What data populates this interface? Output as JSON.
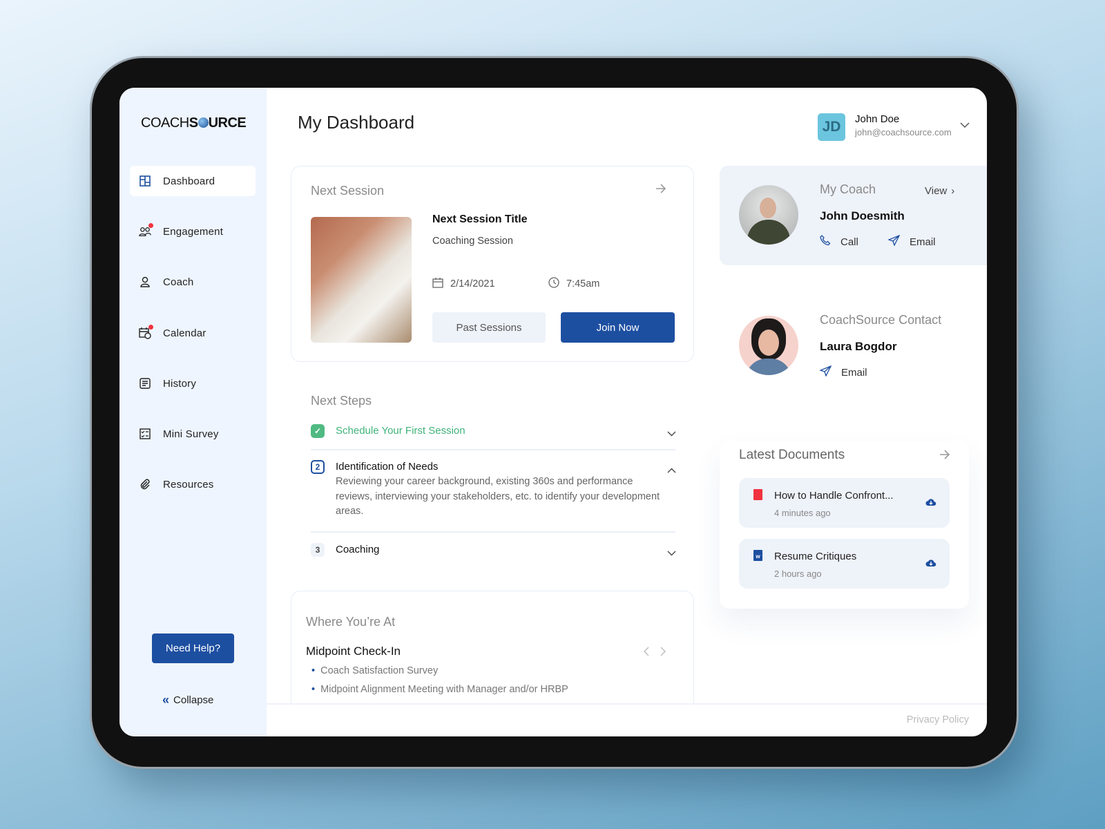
{
  "brand": {
    "logo_left": "COACH",
    "logo_right": "URCE",
    "logo_full": "COACHSOURCE"
  },
  "sidebar": {
    "items": [
      {
        "label": "Dashboard",
        "icon": "dashboard-grid-icon",
        "active": true
      },
      {
        "label": "Engagement",
        "icon": "users-icon",
        "badge": true
      },
      {
        "label": "Coach",
        "icon": "user-icon"
      },
      {
        "label": "Calendar",
        "icon": "calendar-clock-icon",
        "badge": true
      },
      {
        "label": "History",
        "icon": "history-list-icon"
      },
      {
        "label": "Mini Survey",
        "icon": "checklist-icon"
      },
      {
        "label": "Resources",
        "icon": "paperclip-icon"
      }
    ],
    "help_label": "Need Help?",
    "collapse_label": "Collapse"
  },
  "header": {
    "title": "My Dashboard",
    "user": {
      "initials": "JD",
      "name": "John Doe",
      "email": "john@coachsource.com"
    }
  },
  "next_session": {
    "heading": "Next Session",
    "title": "Next Session Title",
    "subtitle": "Coaching Session",
    "date": "2/14/2021",
    "time": "7:45am",
    "past_label": "Past Sessions",
    "join_label": "Join Now"
  },
  "next_steps": {
    "heading": "Next Steps",
    "steps": [
      {
        "marker": "✓",
        "title": "Schedule Your First Session",
        "status": "complete"
      },
      {
        "marker": "2",
        "title": "Identification of Needs",
        "description": "Reviewing your career background, existing 360s and performance reviews, interviewing your stakeholders, etc. to identify your development areas.",
        "status": "current"
      },
      {
        "marker": "3",
        "title": "Coaching",
        "status": "upcoming"
      }
    ]
  },
  "where": {
    "heading": "Where You’re At",
    "title": "Midpoint Check-In",
    "items": [
      "Coach Satisfaction Survey",
      "Midpoint Alignment Meeting with Manager and/or HRBP"
    ]
  },
  "coach": {
    "heading": "My Coach",
    "view_label": "View",
    "name": "John Doesmith",
    "call_label": "Call",
    "email_label": "Email"
  },
  "contact": {
    "heading": "CoachSource Contact",
    "name": "Laura Bogdor",
    "email_label": "Email"
  },
  "documents": {
    "heading": "Latest Documents",
    "items": [
      {
        "title": "How to Handle Confront...",
        "time": "4 minutes ago",
        "type": "pdf"
      },
      {
        "title": "Resume Critiques",
        "time": "2 hours ago",
        "type": "word"
      }
    ]
  },
  "footer": {
    "privacy": "Privacy Policy"
  },
  "colors": {
    "primary": "#1d4fa1",
    "success": "#3fb37a",
    "sidebar_bg": "#eef5fe",
    "badge": "#f0333f"
  }
}
